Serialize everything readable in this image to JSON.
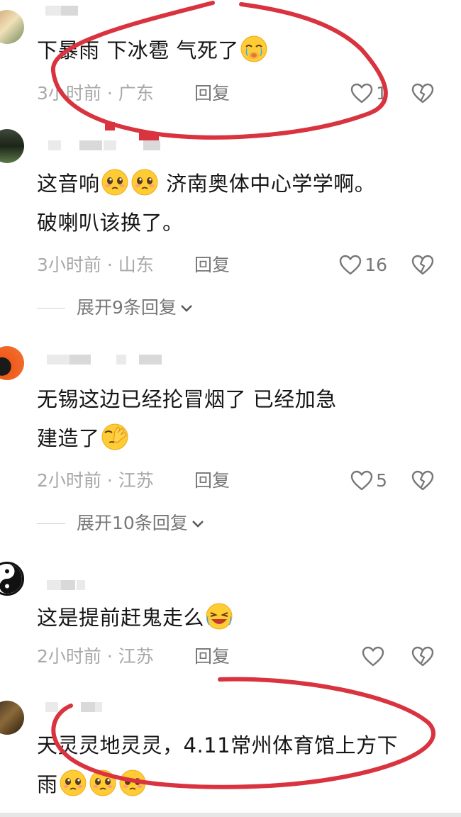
{
  "comments": [
    {
      "text": "下暴雨  下冰雹  气死了",
      "time": "3小时前",
      "location": "广东",
      "reply": "回复",
      "likes": "1",
      "emojis": [
        "crying-emoji"
      ]
    },
    {
      "text_a": "这音响",
      "text_b": "  济南奥体中心学学啊。",
      "text_c": "破喇叭该换了。",
      "time": "3小时前",
      "location": "山东",
      "reply": "回复",
      "likes": "16",
      "expand": "展开9条回复",
      "emojis": [
        "pleading-emoji",
        "pleading-emoji"
      ]
    },
    {
      "text_a": "无锡这边已经抡冒烟了        已经加急",
      "text_b": "建造了",
      "time": "2小时前",
      "location": "江苏",
      "reply": "回复",
      "likes": "5",
      "expand": "展开10条回复",
      "emojis": [
        "facepalm-emoji"
      ]
    },
    {
      "text": "这是提前赶鬼走么",
      "time": "2小时前",
      "location": "江苏",
      "reply": "回复",
      "likes": "",
      "emojis": [
        "laughing-crying-emoji"
      ]
    },
    {
      "text_a": "天灵灵地灵灵，4.11常州体育馆上方下",
      "text_b": "雨",
      "emojis": [
        "pleading-emoji",
        "pleading-emoji",
        "pleading-emoji"
      ]
    }
  ],
  "separator": "·",
  "colors": {
    "meta": "#a8a8a8",
    "action": "#777777",
    "annotation": "#d9333f",
    "emoji": "#ffcc33"
  }
}
